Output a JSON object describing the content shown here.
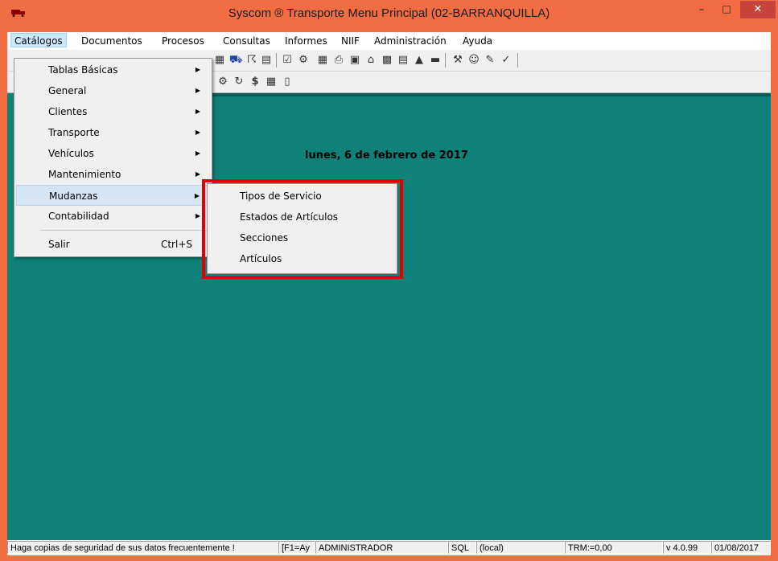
{
  "window": {
    "title": "Syscom ® Transporte Menu Principal (02-BARRANQUILLA)",
    "minimize_glyph": "–",
    "maximize_glyph": "□",
    "close_glyph": "✕"
  },
  "menubar": {
    "items": [
      {
        "label": "Catálogos"
      },
      {
        "label": "Documentos"
      },
      {
        "label": "Procesos"
      },
      {
        "label": "Consultas"
      },
      {
        "label": "Informes"
      },
      {
        "label": "NIIF"
      },
      {
        "label": "Administración"
      },
      {
        "label": "Ayuda"
      }
    ]
  },
  "catalogos_menu": {
    "items": [
      {
        "label": "Tablas Básicas"
      },
      {
        "label": "General"
      },
      {
        "label": "Clientes"
      },
      {
        "label": "Transporte"
      },
      {
        "label": "Vehículos"
      },
      {
        "label": "Mantenimiento"
      },
      {
        "label": "Mudanzas"
      },
      {
        "label": "Contabilidad"
      },
      {
        "label": "Salir",
        "shortcut": "Ctrl+S"
      }
    ],
    "arrow_glyph": "▶"
  },
  "mudanzas_submenu": {
    "items": [
      {
        "label": "Tipos de Servicio"
      },
      {
        "label": "Estados de Artículos"
      },
      {
        "label": "Secciones"
      },
      {
        "label": "Artículos"
      }
    ]
  },
  "content": {
    "date": "lunes, 6 de febrero de 2017"
  },
  "statusbar": {
    "message": "Haga copias de seguridad de sus datos frecuentemente !",
    "help": "[F1=Ay",
    "user": "ADMINISTRADOR",
    "db": "SQL",
    "server": "(local)",
    "trm": "TRM:=0,00",
    "version": "v 4.0.99",
    "date": "01/08/2017"
  },
  "colors": {
    "titlebar": "#f26d41",
    "close_button": "#c7433c",
    "content_background": "#0e8179",
    "highlight_border": "#e30000"
  }
}
